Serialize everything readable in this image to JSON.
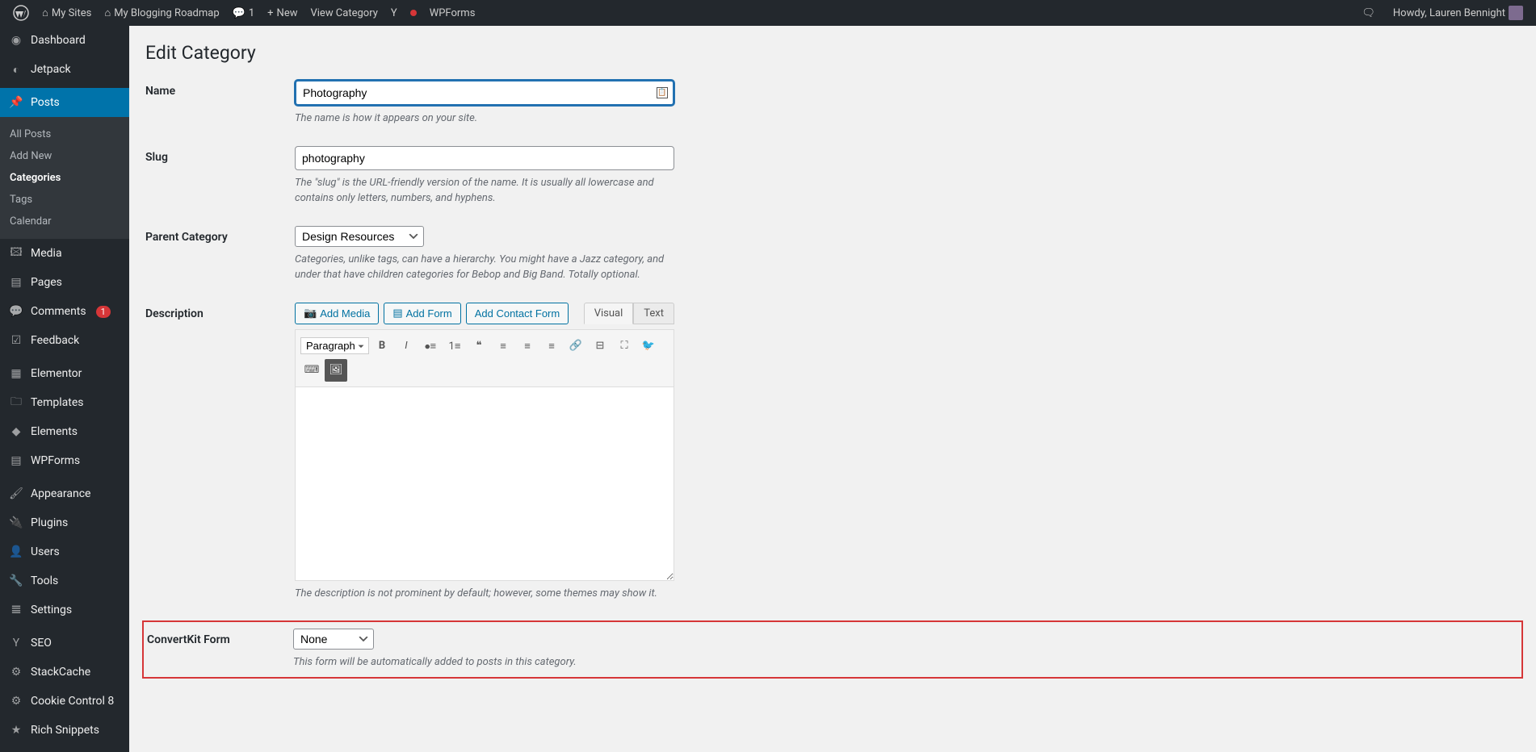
{
  "admin_bar": {
    "my_sites": "My Sites",
    "site_name": "My Blogging Roadmap",
    "comments_count": "1",
    "new_label": "New",
    "view_category": "View Category",
    "wpforms": "WPForms",
    "howdy": "Howdy, Lauren Bennight"
  },
  "sidebar": {
    "dashboard": "Dashboard",
    "jetpack": "Jetpack",
    "posts": "Posts",
    "submenu": {
      "all_posts": "All Posts",
      "add_new": "Add New",
      "categories": "Categories",
      "tags": "Tags",
      "calendar": "Calendar"
    },
    "media": "Media",
    "pages": "Pages",
    "comments": "Comments",
    "comments_badge": "1",
    "feedback": "Feedback",
    "elementor": "Elementor",
    "templates": "Templates",
    "elements": "Elements",
    "wpforms": "WPForms",
    "appearance": "Appearance",
    "plugins": "Plugins",
    "users": "Users",
    "tools": "Tools",
    "settings": "Settings",
    "seo": "SEO",
    "stackcache": "StackCache",
    "cookie_control": "Cookie Control 8",
    "rich_snippets": "Rich Snippets"
  },
  "page": {
    "title": "Edit Category",
    "name_label": "Name",
    "name_value": "Photography",
    "name_desc": "The name is how it appears on your site.",
    "slug_label": "Slug",
    "slug_value": "photography",
    "slug_desc": "The \"slug\" is the URL-friendly version of the name. It is usually all lowercase and contains only letters, numbers, and hyphens.",
    "parent_label": "Parent Category",
    "parent_value": "Design Resources",
    "parent_desc": "Categories, unlike tags, can have a hierarchy. You might have a Jazz category, and under that have children categories for Bebop and Big Band. Totally optional.",
    "desc_label": "Description",
    "add_media": "Add Media",
    "add_form": "Add Form",
    "add_contact_form": "Add Contact Form",
    "tab_visual": "Visual",
    "tab_text": "Text",
    "paragraph": "Paragraph",
    "desc_desc": "The description is not prominent by default; however, some themes may show it.",
    "convertkit_label": "ConvertKit Form",
    "convertkit_value": "None",
    "convertkit_desc": "This form will be automatically added to posts in this category."
  }
}
